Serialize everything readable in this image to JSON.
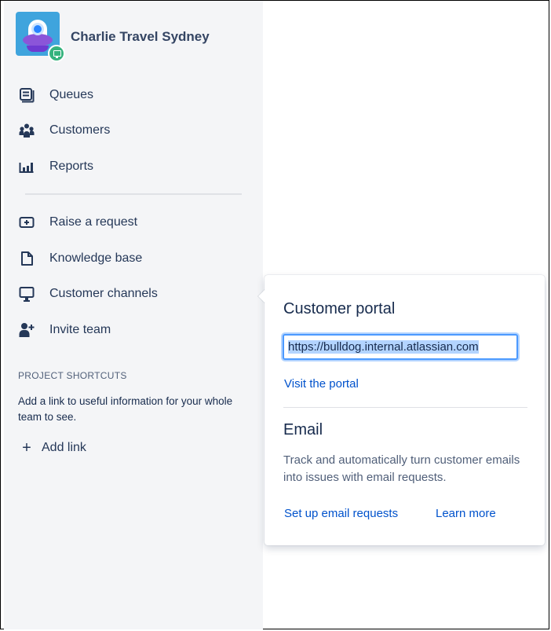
{
  "project": {
    "name": "Charlie Travel Sydney",
    "avatar_icon": "ufo-avatar-icon",
    "badge_icon": "monitor-badge-icon"
  },
  "nav": {
    "primary": [
      {
        "label": "Queues",
        "icon": "queues-icon"
      },
      {
        "label": "Customers",
        "icon": "customers-icon"
      },
      {
        "label": "Reports",
        "icon": "reports-icon"
      }
    ],
    "secondary": [
      {
        "label": "Raise a request",
        "icon": "raise-request-icon"
      },
      {
        "label": "Knowledge base",
        "icon": "knowledge-base-icon"
      },
      {
        "label": "Customer channels",
        "icon": "monitor-icon"
      },
      {
        "label": "Invite team",
        "icon": "invite-team-icon"
      }
    ]
  },
  "shortcuts": {
    "title": "PROJECT SHORTCUTS",
    "description": "Add a link to useful information for your whole team to see.",
    "add_label": "Add link",
    "add_icon": "plus-icon"
  },
  "popover": {
    "portal_title": "Customer portal",
    "portal_url": "https://bulldog.internal.atlassian.com",
    "visit_label": "Visit the portal",
    "email_title": "Email",
    "email_description": "Track and automatically turn customer emails into issues with email requests.",
    "setup_label": "Set up email requests",
    "learn_label": "Learn more"
  },
  "colors": {
    "sidebar_bg": "#f4f5f7",
    "link": "#0052cc",
    "focus_ring": "#4c9aff",
    "badge": "#36b37e",
    "avatar_bg": "#3fa4dd"
  }
}
